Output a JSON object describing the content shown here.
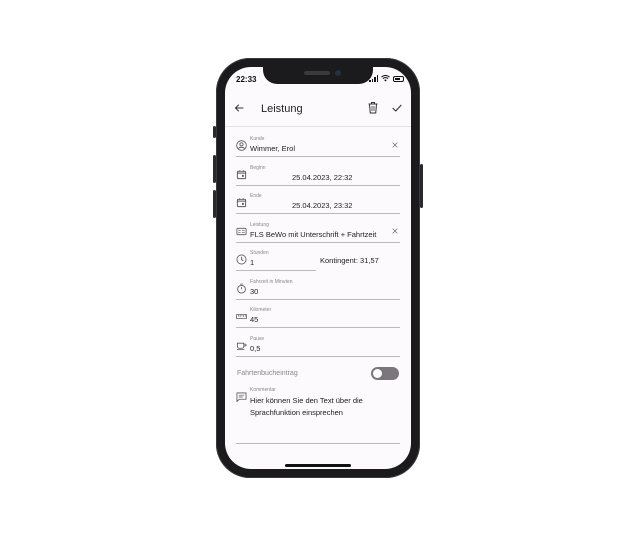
{
  "status": {
    "time": "22:33"
  },
  "header": {
    "title": "Leistung"
  },
  "fields": {
    "kunde": {
      "label": "Kunde",
      "value": "Wimmer, Erol"
    },
    "beginn": {
      "label": "Beginn",
      "value": "25.04.2023, 22:32"
    },
    "ende": {
      "label": "Ende",
      "value": "25.04.2023, 23:32"
    },
    "leistung": {
      "label": "Leistung",
      "value": "FLS BeWo mit Unterschrift + Fahrtzeit"
    },
    "stunden": {
      "label": "Stunden",
      "value": "1",
      "kontingent": "Kontingent: 31,57"
    },
    "fahrzeit": {
      "label": "Fahrzeit in Minuten",
      "value": "30"
    },
    "kilometer": {
      "label": "Kilometer",
      "value": "45"
    },
    "pause": {
      "label": "Pause",
      "value": "0,5"
    }
  },
  "fahrtenbuch": {
    "label": "Fahrtenbucheintrag",
    "enabled": false
  },
  "kommentar": {
    "label": "Kommentar",
    "placeholder": "Hier können Sie den Text über die Sprachfunktion einsprechen"
  },
  "colors": {
    "toggle_off": "#7a767c",
    "background": "#fcfafc"
  }
}
